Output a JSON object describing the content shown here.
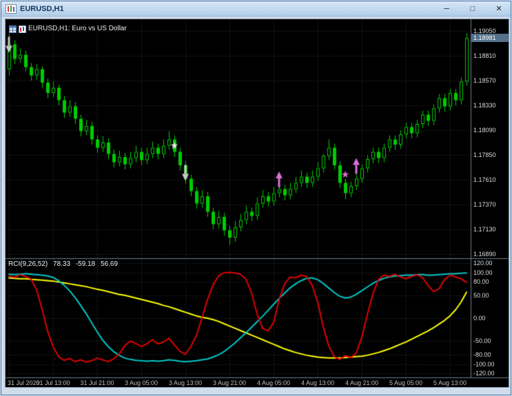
{
  "window": {
    "title": "EURUSD,H1",
    "controls": {
      "minimize": "─",
      "maximize": "□",
      "close": "✕"
    }
  },
  "chart": {
    "header": "EURUSD,H1: Euro vs US Dollar"
  },
  "indicator": {
    "name": "RCI(9,26,52)",
    "values": [
      "78.33",
      "-59.18",
      "56.69"
    ]
  },
  "price_axis": {
    "labels": [
      "1.19050",
      "1.18810",
      "1.18570",
      "1.18330",
      "1.18090",
      "1.17850",
      "1.17610",
      "1.17370",
      "1.17130",
      "1.16890"
    ],
    "current_price": "1.18981"
  },
  "indicator_axis": {
    "labels": [
      "120.00",
      "100.00",
      "80.00",
      "50.00",
      "0.00",
      "-50.00",
      "-80.00",
      "-100.00",
      "-120.00"
    ],
    "values": [
      120,
      100,
      80,
      50,
      0,
      -50,
      -80,
      -100,
      -120
    ]
  },
  "time_axis": {
    "labels": [
      "31 Jul 2020",
      "31 Jul 13:00",
      "31 Jul 21:00",
      "3 Aug 05:00",
      "3 Aug 13:00",
      "3 Aug 21:00",
      "4 Aug 05:00",
      "4 Aug 13:00",
      "4 Aug 21:00",
      "5 Aug 05:00",
      "5 Aug 13:00"
    ],
    "bar_positions": [
      0,
      8,
      16,
      24,
      32,
      40,
      48,
      56,
      64,
      72,
      80
    ]
  },
  "colors": {
    "chart_bg": "#000000",
    "grid": "#333333",
    "candle": "#00cc00",
    "separator": "#6e7e8e",
    "arrow_down": "#c8c8c8",
    "arrow_up": "#da70d6",
    "star_white": "#e8e8e8",
    "price_tag_bg": "#54708c"
  },
  "chart_data": {
    "type": "candlestick",
    "symbol": "EURUSD",
    "timeframe": "H1",
    "price_range": [
      1.1689,
      1.1905
    ],
    "grid_prices": [
      1.1905,
      1.1881,
      1.1857,
      1.1833,
      1.1809,
      1.1785,
      1.1761,
      1.1737,
      1.1713,
      1.1689
    ],
    "candles": [
      [
        1.1868,
        1.1902,
        1.1862,
        1.1892
      ],
      [
        1.1892,
        1.1896,
        1.1873,
        1.1878
      ],
      [
        1.1878,
        1.1888,
        1.1874,
        1.1882
      ],
      [
        1.1882,
        1.1886,
        1.1866,
        1.187
      ],
      [
        1.187,
        1.1874,
        1.1857,
        1.1862
      ],
      [
        1.1862,
        1.1873,
        1.1858,
        1.1868
      ],
      [
        1.1868,
        1.1871,
        1.185,
        1.1855
      ],
      [
        1.1855,
        1.1859,
        1.184,
        1.1845
      ],
      [
        1.1845,
        1.1856,
        1.1841,
        1.185
      ],
      [
        1.185,
        1.1853,
        1.1833,
        1.1838
      ],
      [
        1.1838,
        1.1842,
        1.1821,
        1.1826
      ],
      [
        1.1826,
        1.1838,
        1.1822,
        1.1832
      ],
      [
        1.1832,
        1.1836,
        1.1815,
        1.182
      ],
      [
        1.182,
        1.1824,
        1.1803,
        1.1808
      ],
      [
        1.1808,
        1.1819,
        1.1804,
        1.1813
      ],
      [
        1.1813,
        1.1817,
        1.1795,
        1.18
      ],
      [
        1.18,
        1.1804,
        1.1787,
        1.1792
      ],
      [
        1.1792,
        1.1803,
        1.1788,
        1.1797
      ],
      [
        1.1797,
        1.1801,
        1.1781,
        1.1786
      ],
      [
        1.1786,
        1.179,
        1.1773,
        1.1778
      ],
      [
        1.1778,
        1.1789,
        1.1774,
        1.1783
      ],
      [
        1.1783,
        1.1787,
        1.1771,
        1.1776
      ],
      [
        1.1776,
        1.1788,
        1.1772,
        1.1782
      ],
      [
        1.1782,
        1.1794,
        1.1778,
        1.1788
      ],
      [
        1.1788,
        1.1792,
        1.1775,
        1.178
      ],
      [
        1.178,
        1.1792,
        1.1776,
        1.1786
      ],
      [
        1.1786,
        1.1798,
        1.1782,
        1.1792
      ],
      [
        1.1792,
        1.1796,
        1.1781,
        1.1786
      ],
      [
        1.1786,
        1.18,
        1.1782,
        1.1794
      ],
      [
        1.1794,
        1.1808,
        1.179,
        1.18
      ],
      [
        1.18,
        1.1804,
        1.1783,
        1.1788
      ],
      [
        1.1788,
        1.1792,
        1.177,
        1.1775
      ],
      [
        1.1775,
        1.1779,
        1.1757,
        1.1762
      ],
      [
        1.1762,
        1.1766,
        1.1745,
        1.175
      ],
      [
        1.175,
        1.1754,
        1.1733,
        1.1738
      ],
      [
        1.1738,
        1.1751,
        1.1734,
        1.1745
      ],
      [
        1.1745,
        1.1749,
        1.1725,
        1.173
      ],
      [
        1.173,
        1.1734,
        1.1713,
        1.1718
      ],
      [
        1.1718,
        1.1731,
        1.1714,
        1.1725
      ],
      [
        1.1725,
        1.1729,
        1.1707,
        1.1712
      ],
      [
        1.1712,
        1.1716,
        1.1698,
        1.1705
      ],
      [
        1.1705,
        1.1721,
        1.1701,
        1.1715
      ],
      [
        1.1715,
        1.1728,
        1.1711,
        1.1722
      ],
      [
        1.1722,
        1.1736,
        1.1718,
        1.173
      ],
      [
        1.173,
        1.1734,
        1.1721,
        1.1726
      ],
      [
        1.1726,
        1.1744,
        1.1722,
        1.1738
      ],
      [
        1.1738,
        1.1751,
        1.1734,
        1.1745
      ],
      [
        1.1745,
        1.1749,
        1.1735,
        1.174
      ],
      [
        1.174,
        1.1754,
        1.1736,
        1.1748
      ],
      [
        1.1748,
        1.1758,
        1.1744,
        1.1752
      ],
      [
        1.1752,
        1.1756,
        1.1741,
        1.1746
      ],
      [
        1.1746,
        1.1758,
        1.1742,
        1.1752
      ],
      [
        1.1752,
        1.1764,
        1.1748,
        1.1758
      ],
      [
        1.1758,
        1.177,
        1.1754,
        1.1764
      ],
      [
        1.1764,
        1.1768,
        1.1753,
        1.1758
      ],
      [
        1.1758,
        1.177,
        1.1754,
        1.1764
      ],
      [
        1.1764,
        1.1778,
        1.176,
        1.1772
      ],
      [
        1.1772,
        1.1786,
        1.1768,
        1.1784
      ],
      [
        1.1784,
        1.18,
        1.178,
        1.1792
      ],
      [
        1.1792,
        1.1796,
        1.1771,
        1.1775
      ],
      [
        1.1775,
        1.1779,
        1.1753,
        1.1758
      ],
      [
        1.1758,
        1.1762,
        1.1742,
        1.1748
      ],
      [
        1.1748,
        1.1759,
        1.1744,
        1.1755
      ],
      [
        1.1755,
        1.1766,
        1.1751,
        1.1762
      ],
      [
        1.1762,
        1.1776,
        1.1758,
        1.1772
      ],
      [
        1.1772,
        1.1785,
        1.1768,
        1.1781
      ],
      [
        1.1781,
        1.1792,
        1.1777,
        1.1788
      ],
      [
        1.1788,
        1.1792,
        1.1777,
        1.1782
      ],
      [
        1.1782,
        1.1796,
        1.1778,
        1.1792
      ],
      [
        1.1792,
        1.1804,
        1.1788,
        1.18
      ],
      [
        1.18,
        1.1804,
        1.179,
        1.1795
      ],
      [
        1.1795,
        1.1809,
        1.1791,
        1.1805
      ],
      [
        1.1805,
        1.1816,
        1.1801,
        1.1812
      ],
      [
        1.1812,
        1.1816,
        1.1801,
        1.1806
      ],
      [
        1.1806,
        1.1819,
        1.1802,
        1.1815
      ],
      [
        1.1815,
        1.1828,
        1.1811,
        1.1824
      ],
      [
        1.1824,
        1.1828,
        1.1813,
        1.1818
      ],
      [
        1.1818,
        1.1834,
        1.1814,
        1.183
      ],
      [
        1.183,
        1.1844,
        1.1826,
        1.184
      ],
      [
        1.184,
        1.1844,
        1.1827,
        1.1832
      ],
      [
        1.1832,
        1.1849,
        1.1828,
        1.1845
      ],
      [
        1.1845,
        1.1849,
        1.1833,
        1.1838
      ],
      [
        1.1838,
        1.186,
        1.1834,
        1.1856
      ],
      [
        1.1856,
        1.1903,
        1.1852,
        1.18981
      ]
    ],
    "markers": [
      {
        "bar": 0,
        "price": 1.1884,
        "type": "arrow-down",
        "color": "#c8c8c8"
      },
      {
        "bar": 30,
        "price": 1.1794,
        "type": "star",
        "color": "#e8e8e8"
      },
      {
        "bar": 32,
        "price": 1.176,
        "type": "arrow-down",
        "color": "#c8c8c8"
      },
      {
        "bar": 49,
        "price": 1.1769,
        "type": "arrow-up",
        "color": "#da70d6"
      },
      {
        "bar": 61,
        "price": 1.1766,
        "type": "star",
        "color": "#da70d6"
      },
      {
        "bar": 63,
        "price": 1.1782,
        "type": "arrow-up",
        "color": "#da70d6"
      }
    ],
    "indicator": {
      "name": "RCI(9,26,52)",
      "range": [
        -120,
        120
      ],
      "current_values": [
        78.33,
        -59.18,
        56.69
      ],
      "series": [
        {
          "name": "rci_9",
          "color": "#e00000",
          "values": [
            92,
            89,
            95,
            91,
            86,
            62,
            20,
            -28,
            -62,
            -84,
            -92,
            -88,
            -95,
            -91,
            -96,
            -93,
            -87,
            -91,
            -95,
            -89,
            -78,
            -60,
            -50,
            -55,
            -62,
            -56,
            -47,
            -56,
            -52,
            -44,
            -58,
            -72,
            -79,
            -62,
            -38,
            0,
            40,
            72,
            92,
            99,
            100,
            99,
            96,
            85,
            55,
            10,
            -22,
            -28,
            -10,
            40,
            75,
            90,
            88,
            94,
            91,
            72,
            35,
            -18,
            -60,
            -84,
            -90,
            -82,
            -86,
            -76,
            -42,
            8,
            52,
            84,
            94,
            91,
            96,
            90,
            86,
            91,
            95,
            89,
            72,
            58,
            64,
            84,
            94,
            90,
            86,
            78.33
          ]
        },
        {
          "name": "rci_26",
          "color": "#00c8c8",
          "values": [
            96,
            95,
            96,
            97,
            96,
            95,
            94,
            92,
            89,
            82,
            72,
            60,
            45,
            28,
            10,
            -10,
            -30,
            -48,
            -62,
            -73,
            -81,
            -87,
            -90,
            -92,
            -93,
            -94,
            -93,
            -94,
            -93,
            -91,
            -92,
            -94,
            -95,
            -94,
            -93,
            -91,
            -89,
            -85,
            -80,
            -73,
            -64,
            -54,
            -43,
            -32,
            -20,
            -8,
            4,
            17,
            30,
            43,
            55,
            66,
            75,
            82,
            87,
            88,
            84,
            76,
            66,
            56,
            48,
            44,
            46,
            52,
            60,
            68,
            76,
            82,
            87,
            90,
            92,
            93,
            94,
            94,
            95,
            95,
            94,
            94,
            95,
            96,
            97,
            97,
            98,
            99
          ]
        },
        {
          "name": "rci_52",
          "color": "#ffff00",
          "values": [
            88,
            87,
            86,
            86,
            85,
            84,
            83,
            82,
            81,
            79,
            77,
            75,
            73,
            71,
            69,
            66,
            63,
            61,
            58,
            55,
            52,
            50,
            47,
            44,
            41,
            38,
            35,
            32,
            28,
            25,
            21,
            17,
            13,
            9,
            5,
            2,
            0,
            -3,
            -7,
            -12,
            -17,
            -22,
            -27,
            -32,
            -37,
            -42,
            -47,
            -52,
            -57,
            -62,
            -67,
            -71,
            -75,
            -78,
            -81,
            -83,
            -85,
            -86,
            -87,
            -87,
            -87,
            -86,
            -85,
            -84,
            -83,
            -81,
            -78,
            -75,
            -71,
            -67,
            -62,
            -57,
            -52,
            -46,
            -40,
            -34,
            -28,
            -21,
            -13,
            -5,
            5,
            18,
            35,
            56.69
          ]
        }
      ]
    }
  }
}
